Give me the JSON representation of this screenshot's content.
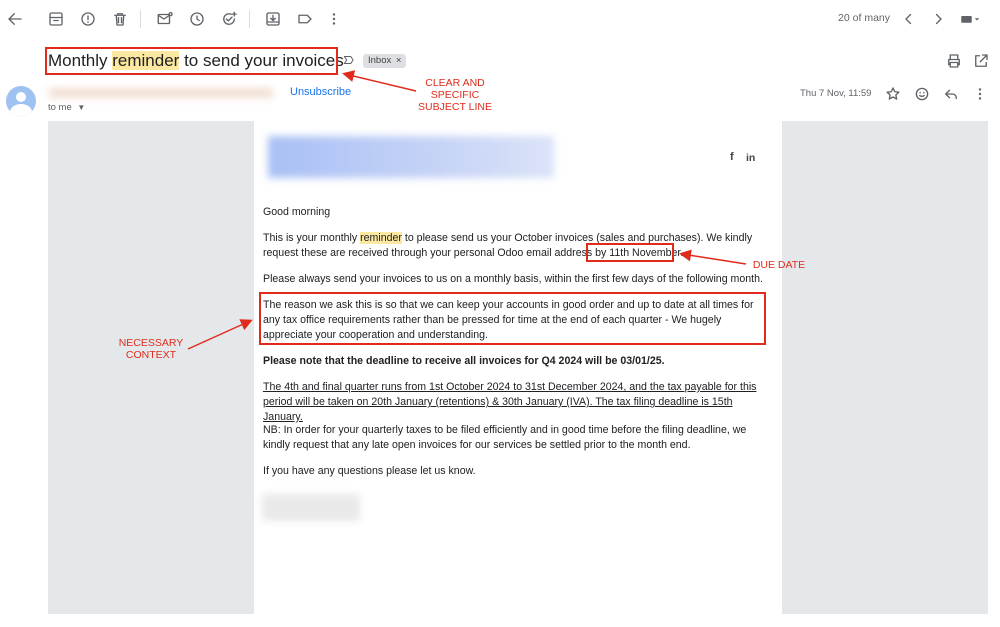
{
  "toolbar": {
    "back_icon": "arrow-left-icon",
    "icons": [
      "archive-icon",
      "report-spam-icon",
      "delete-icon",
      "mark-unread-icon",
      "snooze-icon",
      "add-task-icon",
      "move-to-icon",
      "label-icon",
      "more-vert-icon"
    ],
    "pagination": "20 of many"
  },
  "email": {
    "subject_before": "Monthly ",
    "subject_highlight": "reminder",
    "subject_after": " to send your invoices",
    "label_chip": "Inbox",
    "unsubscribe": "Unsubscribe",
    "to_me": "to me",
    "date": "Thu 7 Nov, 11:59"
  },
  "body": {
    "greeting": "Good morning",
    "p1_before": "This is your monthly ",
    "p1_highlight": "reminder",
    "p1_after": " to please send us your October invoices (sales and purchases). We kindly request these are received through your personal Odoo email address ",
    "p1_due": "by 11th November.",
    "p2": "Please always send your invoices to us on a monthly basis, within the first few days of the following month.",
    "p3": "The reason we ask this is so that we can keep your accounts in good order and up to date at all times for any tax office requirements rather than be pressed for time at the end of each quarter - We hugely appreciate your cooperation and understanding.",
    "p4": "Please note that the deadline to receive all invoices for Q4 2024 will be 03/01/25.",
    "p5": "The 4th and final quarter runs from 1st October 2024 to 31st December 2024, and the tax payable for this period will be taken on 20th January (retentions) & 30th January (IVA).  The tax filing deadline is 15th January.",
    "p6": "NB: In order for your quarterly taxes to be filed efficiently and in good time before the filing deadline, we kindly request that any late open invoices for our services be settled prior to the month end.",
    "p7": "If you have any questions please let us know.",
    "social": {
      "facebook": "f",
      "linkedin": "in"
    }
  },
  "annotations": {
    "subject": "CLEAR AND\nSPECIFIC\nSUBJECT LINE",
    "due_date": "DUE DATE",
    "context": "NECESSARY\nCONTEXT"
  },
  "colors": {
    "annotation_red": "#e02b1c",
    "highlight": "#fce8a0",
    "link_blue": "#1a73e8",
    "gutter_gray": "#e5e8ea"
  }
}
